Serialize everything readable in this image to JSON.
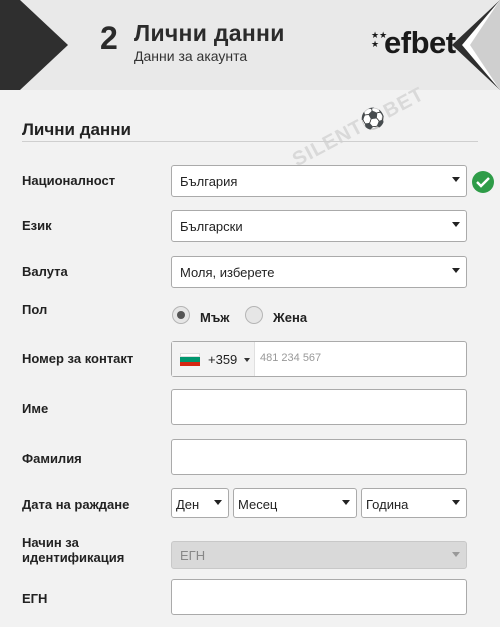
{
  "header": {
    "step_number": "2",
    "title": "Лични данни",
    "subtitle": "Данни за акаунта",
    "logo_text": "efbet",
    "logo_stars": "★★\n★"
  },
  "section": {
    "title": "Лични данни"
  },
  "watermark": "SILENT⚽BET",
  "fields": {
    "nationality": {
      "label": "Националност",
      "value": "България"
    },
    "language": {
      "label": "Език",
      "value": "Български"
    },
    "currency": {
      "label": "Валута",
      "value": "Моля, изберете"
    },
    "gender": {
      "label": "Пол",
      "options": [
        "Мъж",
        "Жена"
      ],
      "selected": "Мъж"
    },
    "phone": {
      "label": "Номер за контакт",
      "country_code": "+359",
      "placeholder": "481 234 567"
    },
    "first_name": {
      "label": "Име",
      "value": ""
    },
    "last_name": {
      "label": "Фамилия",
      "value": ""
    },
    "birth_date": {
      "label": "Дата на раждане",
      "day": "Ден",
      "month": "Месец",
      "year": "Година"
    },
    "id_method": {
      "label": "Начин за идентификация",
      "value": "ЕГН"
    },
    "egn": {
      "label": "ЕГН",
      "value": ""
    }
  },
  "colors": {
    "success": "#2e9c48",
    "dark": "#2f2f2f",
    "flag": [
      "#ffffff",
      "#00966e",
      "#d62612"
    ]
  }
}
